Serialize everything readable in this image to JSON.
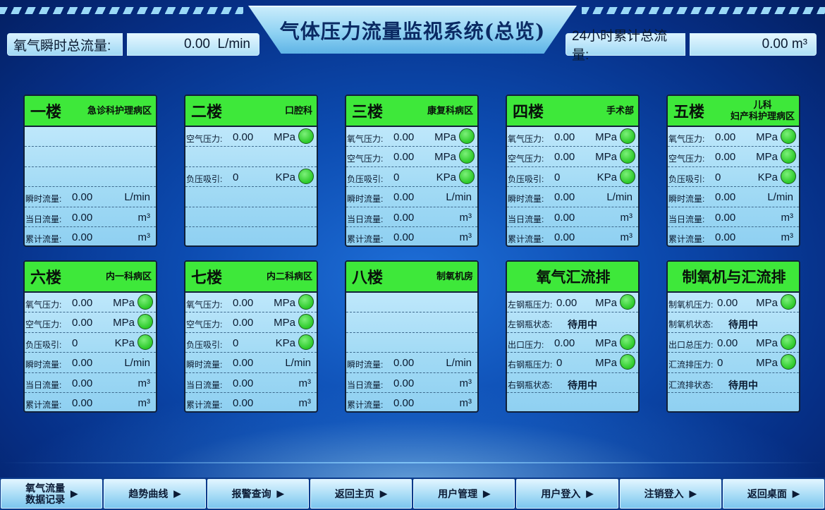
{
  "header": {
    "title": "气体压力流量监视系统(总览)",
    "left_label": "氧气瞬时总流量:",
    "left_value": "0.00",
    "left_unit": "L/min",
    "right_label": "24小时累计总流量:",
    "right_value": "0.00",
    "right_unit": "m³"
  },
  "cards": [
    {
      "floor": "一楼",
      "dept": "急诊科护理病区",
      "rows": [
        {
          "label": "",
          "value": "",
          "unit": ""
        },
        {
          "label": "",
          "value": "",
          "unit": ""
        },
        {
          "label": "",
          "value": "",
          "unit": ""
        },
        {
          "label": "瞬时流量:",
          "value": "0.00",
          "unit": "L/min"
        },
        {
          "label": "当日流量:",
          "value": "0.00",
          "unit": "m³"
        },
        {
          "label": "累计流量:",
          "value": "0.00",
          "unit": "m³"
        }
      ]
    },
    {
      "floor": "二楼",
      "dept": "口腔科",
      "rows": [
        {
          "label": "空气压力:",
          "value": "0.00",
          "unit": "MPa",
          "led": true
        },
        {
          "label": "",
          "value": "",
          "unit": ""
        },
        {
          "label": "负压吸引:",
          "value": "0",
          "unit": "KPa",
          "led": true
        },
        {
          "label": "",
          "value": "",
          "unit": ""
        },
        {
          "label": "",
          "value": "",
          "unit": ""
        },
        {
          "label": "",
          "value": "",
          "unit": ""
        }
      ]
    },
    {
      "floor": "三楼",
      "dept": "康复科病区",
      "rows": [
        {
          "label": "氧气压力:",
          "value": "0.00",
          "unit": "MPa",
          "led": true
        },
        {
          "label": "空气压力:",
          "value": "0.00",
          "unit": "MPa",
          "led": true
        },
        {
          "label": "负压吸引:",
          "value": "0",
          "unit": "KPa",
          "led": true
        },
        {
          "label": "瞬时流量:",
          "value": "0.00",
          "unit": "L/min"
        },
        {
          "label": "当日流量:",
          "value": "0.00",
          "unit": "m³"
        },
        {
          "label": "累计流量:",
          "value": "0.00",
          "unit": "m³"
        }
      ]
    },
    {
      "floor": "四楼",
      "dept": "手术部",
      "rows": [
        {
          "label": "氧气压力:",
          "value": "0.00",
          "unit": "MPa",
          "led": true
        },
        {
          "label": "空气压力:",
          "value": "0.00",
          "unit": "MPa",
          "led": true
        },
        {
          "label": "负压吸引:",
          "value": "0",
          "unit": "KPa",
          "led": true
        },
        {
          "label": "瞬时流量:",
          "value": "0.00",
          "unit": "L/min"
        },
        {
          "label": "当日流量:",
          "value": "0.00",
          "unit": "m³"
        },
        {
          "label": "累计流量:",
          "value": "0.00",
          "unit": "m³"
        }
      ]
    },
    {
      "floor": "五楼",
      "dept": "儿科\n妇产科护理病区",
      "rows": [
        {
          "label": "氧气压力:",
          "value": "0.00",
          "unit": "MPa",
          "led": true
        },
        {
          "label": "空气压力:",
          "value": "0.00",
          "unit": "MPa",
          "led": true
        },
        {
          "label": "负压吸引:",
          "value": "0",
          "unit": "KPa",
          "led": true
        },
        {
          "label": "瞬时流量:",
          "value": "0.00",
          "unit": "L/min"
        },
        {
          "label": "当日流量:",
          "value": "0.00",
          "unit": "m³"
        },
        {
          "label": "累计流量:",
          "value": "0.00",
          "unit": "m³"
        }
      ]
    },
    {
      "floor": "六楼",
      "dept": "内一科病区",
      "rows": [
        {
          "label": "氧气压力:",
          "value": "0.00",
          "unit": "MPa",
          "led": true
        },
        {
          "label": "空气压力:",
          "value": "0.00",
          "unit": "MPa",
          "led": true
        },
        {
          "label": "负压吸引:",
          "value": "0",
          "unit": "KPa",
          "led": true
        },
        {
          "label": "瞬时流量:",
          "value": "0.00",
          "unit": "L/min"
        },
        {
          "label": "当日流量:",
          "value": "0.00",
          "unit": "m³"
        },
        {
          "label": "累计流量:",
          "value": "0.00",
          "unit": "m³"
        }
      ]
    },
    {
      "floor": "七楼",
      "dept": "内二科病区",
      "rows": [
        {
          "label": "氧气压力:",
          "value": "0.00",
          "unit": "MPa",
          "led": true
        },
        {
          "label": "空气压力:",
          "value": "0.00",
          "unit": "MPa",
          "led": true
        },
        {
          "label": "负压吸引:",
          "value": "0",
          "unit": "KPa",
          "led": true
        },
        {
          "label": "瞬时流量:",
          "value": "0.00",
          "unit": "L/min"
        },
        {
          "label": "当日流量:",
          "value": "0.00",
          "unit": "m³"
        },
        {
          "label": "累计流量:",
          "value": "0.00",
          "unit": "m³"
        }
      ]
    },
    {
      "floor": "八楼",
      "dept": "制氧机房",
      "rows": [
        {
          "label": "",
          "value": "",
          "unit": ""
        },
        {
          "label": "",
          "value": "",
          "unit": ""
        },
        {
          "label": "",
          "value": "",
          "unit": ""
        },
        {
          "label": "瞬时流量:",
          "value": "0.00",
          "unit": "L/min"
        },
        {
          "label": "当日流量:",
          "value": "0.00",
          "unit": "m³"
        },
        {
          "label": "累计流量:",
          "value": "0.00",
          "unit": "m³"
        }
      ]
    },
    {
      "floor": "氧气汇流排",
      "dept": "",
      "rows": [
        {
          "label": "左钢瓶压力:",
          "value": "0.00",
          "unit": "MPa",
          "led": true
        },
        {
          "label": "左钢瓶状态:",
          "status": "待用中"
        },
        {
          "label": "出口压力:",
          "value": "0.00",
          "unit": "MPa",
          "led": true
        },
        {
          "label": "右钢瓶压力:",
          "value": "0",
          "unit": "MPa",
          "led": true
        },
        {
          "label": "右钢瓶状态:",
          "status": "待用中"
        },
        {
          "label": "",
          "value": "",
          "unit": ""
        }
      ]
    },
    {
      "floor": "制氧机与汇流排",
      "dept": "",
      "rows": [
        {
          "label": "制氧机压力:",
          "value": "0.00",
          "unit": "MPa",
          "led": true
        },
        {
          "label": "制氧机状态:",
          "status": "待用中"
        },
        {
          "label": "出口总压力:",
          "value": "0.00",
          "unit": "MPa",
          "led": true
        },
        {
          "label": "汇流排压力:",
          "value": "0",
          "unit": "MPa",
          "led": true
        },
        {
          "label": "汇流排状态:",
          "status": "待用中"
        },
        {
          "label": "",
          "value": "",
          "unit": ""
        }
      ]
    }
  ],
  "nav": [
    {
      "label": "氧气流量\n数据记录"
    },
    {
      "label": "趋势曲线"
    },
    {
      "label": "报警查询"
    },
    {
      "label": "返回主页"
    },
    {
      "label": "用户管理"
    },
    {
      "label": "用户登入"
    },
    {
      "label": "注销登入"
    },
    {
      "label": "返回桌面"
    }
  ],
  "colors": {
    "header_green": "#3ee83a",
    "led_green": "#2bc928",
    "background": "#0c4bb0"
  }
}
